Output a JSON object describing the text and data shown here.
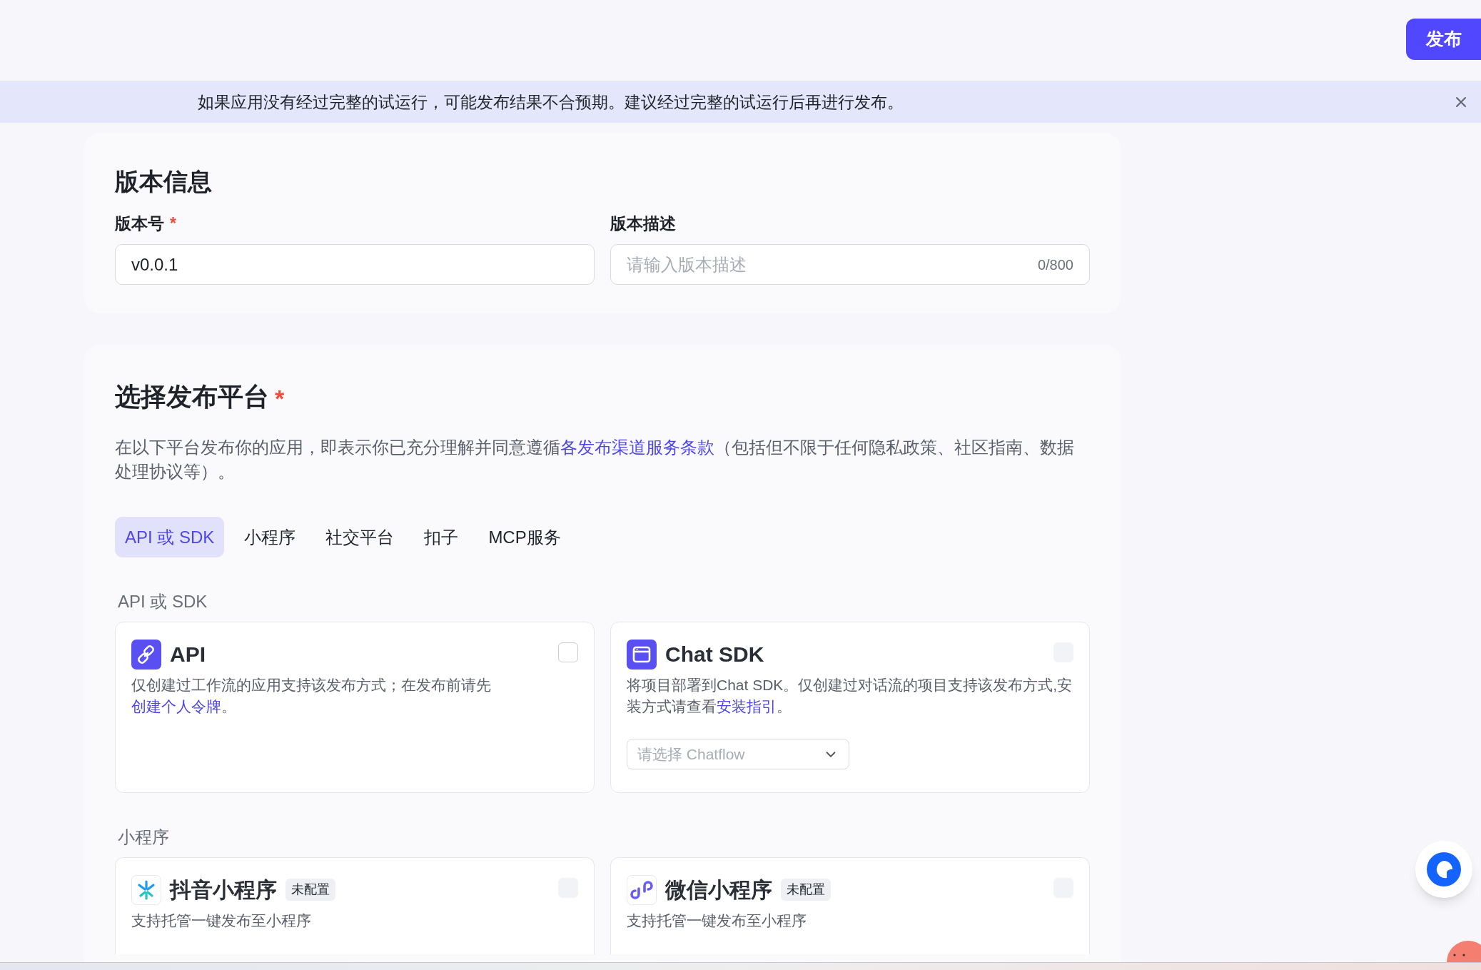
{
  "header": {
    "publish_button": "发布"
  },
  "banner": {
    "text": "如果应用没有经过完整的试运行，可能发布结果不合预期。建议经过完整的试运行后再进行发布。"
  },
  "version_info": {
    "title": "版本信息",
    "fields": [
      {
        "label": "版本号",
        "required_mark": "*",
        "value": "v0.0.1"
      },
      {
        "label": "版本描述",
        "placeholder": "请输入版本描述",
        "counter": "0/800"
      }
    ]
  },
  "platform": {
    "title": "选择发布平台",
    "required": true,
    "required_mark": "*",
    "description": [
      {
        "kind": "text",
        "text": "在以下平台发布你的应用，即表示你已充分理解并同意遵循"
      },
      {
        "kind": "link",
        "text": "各发布渠道服务条款"
      },
      {
        "kind": "text",
        "text": "（包括但不限于任何隐私政策、社区指南、数据处理协议等）。"
      }
    ],
    "tabs": [
      {
        "label": "API 或 SDK",
        "selected": true
      },
      {
        "label": "小程序",
        "selected": false
      },
      {
        "label": "社交平台",
        "selected": false
      },
      {
        "label": "扣子",
        "selected": false
      },
      {
        "label": "MCP服务",
        "selected": false
      }
    ],
    "sections": [
      {
        "label": "API 或 SDK",
        "cards": [
          {
            "kind": "api",
            "title": "API",
            "disabled": false,
            "checked": false,
            "description": [
              {
                "kind": "text",
                "text": "仅创建过工作流的应用支持该发布方式；在发布前请先"
              },
              {
                "kind": "link",
                "text": "创建个人令牌"
              },
              {
                "kind": "text",
                "text": "。"
              }
            ]
          },
          {
            "kind": "chat-sdk",
            "title": "Chat SDK",
            "disabled": true,
            "checked": false,
            "description": [
              {
                "kind": "text",
                "text": "将项目部署到Chat SDK。仅创建过对话流的项目支持该发布方式,安装方式请查看"
              },
              {
                "kind": "link",
                "text": "安装指引"
              },
              {
                "kind": "text",
                "text": "。"
              }
            ],
            "select_placeholder": "请选择 Chatflow"
          }
        ]
      },
      {
        "label": "小程序",
        "cards": [
          {
            "kind": "douyin",
            "title": "抖音小程序",
            "badge": "未配置",
            "disabled": true,
            "checked": false,
            "description": [
              {
                "kind": "text",
                "text": "支持托管一键发布至小程序"
              }
            ]
          },
          {
            "kind": "wechat",
            "title": "微信小程序",
            "badge": "未配置",
            "disabled": true,
            "checked": false,
            "description": [
              {
                "kind": "text",
                "text": "支持托管一键发布至小程序"
              }
            ]
          }
        ]
      }
    ]
  }
}
